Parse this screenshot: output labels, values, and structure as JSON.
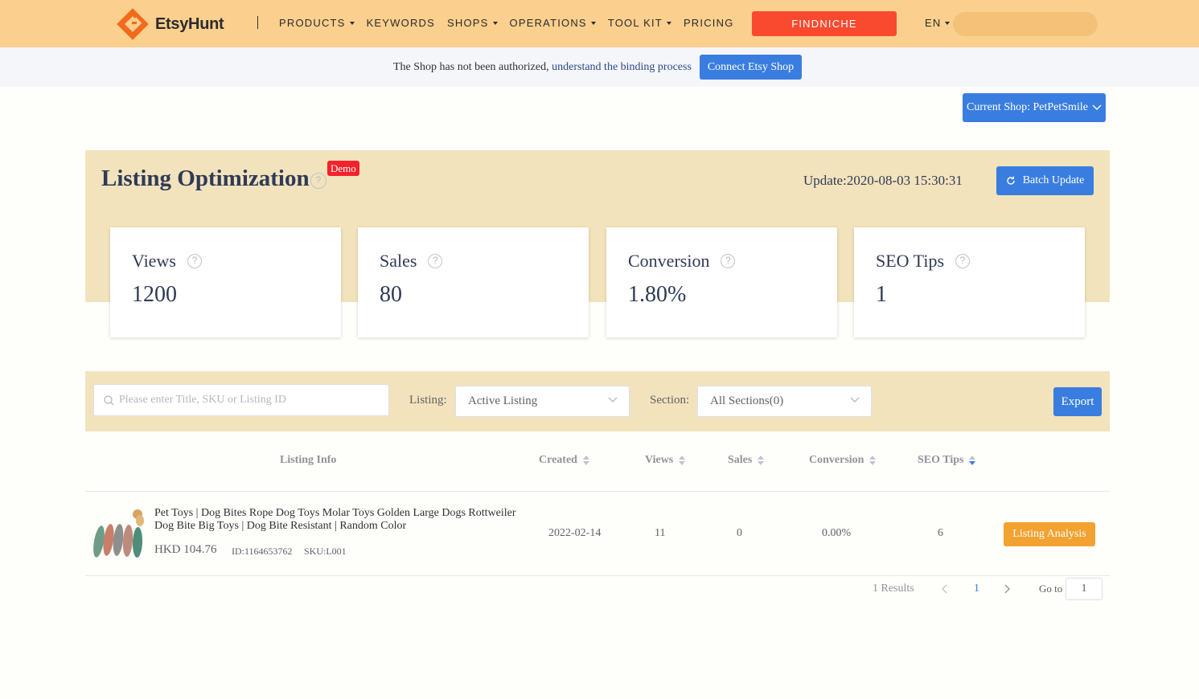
{
  "header": {
    "logo_text": "EtsyHunt",
    "nav": [
      {
        "label": "PRODUCTS",
        "has_dropdown": true
      },
      {
        "label": "KEYWORDS",
        "has_dropdown": false
      },
      {
        "label": "SHOPS",
        "has_dropdown": true
      },
      {
        "label": "OPERATIONS",
        "has_dropdown": true
      },
      {
        "label": "TOOL KIT",
        "has_dropdown": true
      },
      {
        "label": "PRICING",
        "has_dropdown": false
      }
    ],
    "findniche_label": "FINDNICHE",
    "language": "EN",
    "colors": {
      "bar": "#fbcf8e",
      "findniche": "#f94a2f",
      "logo": "#f26b1d"
    }
  },
  "notice": {
    "text": "The Shop has not been authorized, ",
    "link": "understand the binding process",
    "connect_button": "Connect Etsy Shop"
  },
  "shop_selector": {
    "label": "Current Shop: PetPetSmile"
  },
  "overview": {
    "title": "Listing Optimization",
    "demo_badge": "Demo",
    "update_text": "Update:2020-08-03 15:30:31",
    "batch_update_label": "Batch Update",
    "cards": [
      {
        "label": "Views",
        "value": "1200"
      },
      {
        "label": "Sales",
        "value": "80"
      },
      {
        "label": "Conversion",
        "value": "1.80%"
      },
      {
        "label": "SEO Tips",
        "value": "1"
      }
    ]
  },
  "filters": {
    "search_placeholder": "Please enter Title, SKU or Listing ID",
    "listing_label": "Listing:",
    "listing_value": "Active Listing",
    "section_label": "Section:",
    "section_value": "All Sections(0)",
    "export_label": "Export"
  },
  "table": {
    "headers": {
      "listing_info": "Listing Info",
      "created": "Created",
      "views": "Views",
      "sales": "Sales",
      "conversion": "Conversion",
      "seo_tips": "SEO Tips"
    },
    "rows": [
      {
        "title": "Pet Toys | Dog Bites Rope Dog Toys Molar Toys Golden Large Dogs Rottweiler Dog Bite Big Toys | Dog Bite Resistant | Random Color",
        "price": "HKD 104.76",
        "id": "ID:1164653762",
        "sku": "SKU:L001",
        "created": "2022-02-14",
        "views": "11",
        "sales": "0",
        "conversion": "0.00%",
        "seo_tips": "6",
        "action": "Listing Analysis"
      }
    ]
  },
  "pagination": {
    "total": "1 Results",
    "current_page": "1",
    "goto_label": "Go to",
    "goto_value": "1"
  }
}
